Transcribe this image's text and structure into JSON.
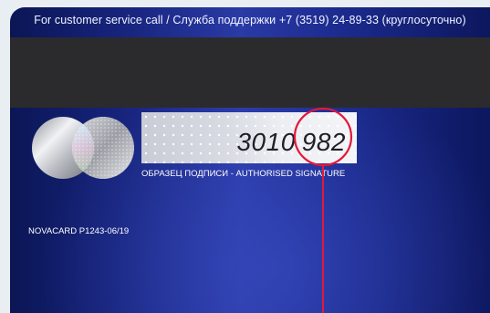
{
  "card": {
    "service_line": "For customer service call / Служба поддержки +7 (3519) 24-89-33 (круглосуточно)",
    "signature_panel": {
      "number": "3010",
      "cvv": "982"
    },
    "signature_caption": "ОБРАЗЕЦ ПОДПИСИ - AUTHORISED SIGNATURE",
    "card_id": "NOVACARD P1243-06/19"
  },
  "colors": {
    "card_blue_dark": "#0b1656",
    "card_blue_light": "#2a3aa6",
    "magnetic_stripe": "#2b2b2d",
    "highlight_red": "#e2193a"
  }
}
